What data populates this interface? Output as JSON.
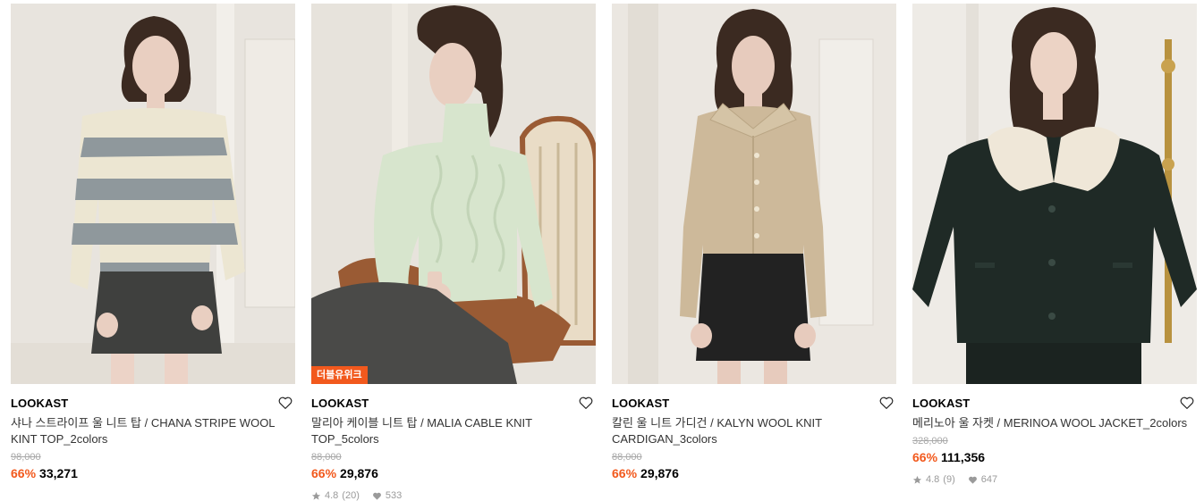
{
  "products": [
    {
      "brand": "LOOKAST",
      "name": "샤나 스트라이프 울 니트 탑 / CHANA STRIPE WOOL KINT TOP_2colors",
      "original_price": "98,000",
      "discount": "66%",
      "price": "33,271",
      "badge": "",
      "rating": "",
      "reviews": "",
      "likes": "",
      "image_palette": {
        "bg": "#e8e4de",
        "top": "#ece6d2",
        "stripe": "#8f989c",
        "skirt": "#3f403e",
        "skin": "#e9cfc1",
        "hair": "#3b2a21"
      }
    },
    {
      "brand": "LOOKAST",
      "name": "말리아 케이블 니트 탑 / MALIA CABLE KNIT TOP_5colors",
      "original_price": "88,000",
      "discount": "66%",
      "price": "29,876",
      "badge": "더블유위크",
      "rating": "4.8",
      "reviews": "(20)",
      "likes": "533",
      "image_palette": {
        "bg": "#e7e3dc",
        "top": "#d7e5cd",
        "chair": "#9a5b34",
        "skirt": "#4a4a48",
        "skin": "#e9cfc1",
        "hair": "#3b2a21"
      }
    },
    {
      "brand": "LOOKAST",
      "name": "칼린 울 니트 가디건 / KALYN WOOL KNIT CARDIGAN_3colors",
      "original_price": "88,000",
      "discount": "66%",
      "price": "29,876",
      "badge": "",
      "rating": "",
      "reviews": "",
      "likes": "",
      "image_palette": {
        "bg": "#ebe7e1",
        "top": "#cdb99a",
        "skirt": "#222222",
        "skin": "#e7cbbd",
        "hair": "#3b2a21"
      }
    },
    {
      "brand": "LOOKAST",
      "name": "메리노아 울 자켓 / MERINOA WOOL JACKET_2colors",
      "original_price": "328,000",
      "discount": "66%",
      "price": "111,356",
      "badge": "",
      "rating": "4.8",
      "reviews": "(9)",
      "likes": "647",
      "image_palette": {
        "bg": "#eeebe6",
        "top": "#1f2a26",
        "collar": "#efe7d8",
        "brass": "#b8923f",
        "skin": "#ecd3c5",
        "hair": "#3b2a21"
      }
    }
  ]
}
